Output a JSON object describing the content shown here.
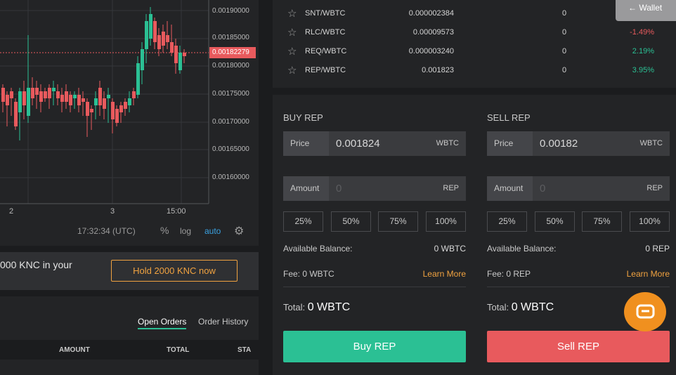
{
  "chart": {
    "price_ticks": [
      "0.00190000",
      "0.00185000",
      "0.00180000",
      "0.00175000",
      "0.00170000",
      "0.00165000",
      "0.00160000"
    ],
    "current_price": "0.00182279",
    "x_ticks": [
      "2",
      "3",
      "15:00"
    ],
    "time": "17:32:34 (UTC)",
    "pct": "%",
    "log": "log",
    "auto": "auto",
    "colors": {
      "up": "#2bc094",
      "down": "#e85a5d"
    }
  },
  "promo": {
    "text": "000 KNC in your",
    "button": "Hold 2000 KNC now"
  },
  "orders": {
    "tabs": [
      "Open Orders",
      "Order History"
    ],
    "columns": [
      "AMOUNT",
      "TOTAL",
      "STA"
    ]
  },
  "market": {
    "rows": [
      {
        "pair": "SNT/WBTC",
        "price": "0.000002384",
        "volume": "0",
        "change": "",
        "change_color": "#d4d4d4"
      },
      {
        "pair": "RLC/WBTC",
        "price": "0.00009573",
        "volume": "0",
        "change": "-1.49%",
        "change_color": "#e85a5d"
      },
      {
        "pair": "REQ/WBTC",
        "price": "0.000003240",
        "volume": "0",
        "change": "2.19%",
        "change_color": "#2bc094"
      },
      {
        "pair": "REP/WBTC",
        "price": "0.001823",
        "volume": "0",
        "change": "3.95%",
        "change_color": "#2bc094"
      }
    ],
    "wallet": "← Wallet"
  },
  "buy": {
    "title": "BUY REP",
    "price_label": "Price",
    "price_value": "0.001824",
    "price_unit": "WBTC",
    "amount_label": "Amount",
    "amount_placeholder": "0",
    "amount_unit": "REP",
    "pcts": [
      "25%",
      "50%",
      "75%",
      "100%"
    ],
    "available_label": "Available Balance:",
    "available_value": "0 WBTC",
    "fee": "Fee: 0 WBTC",
    "learn_more": "Learn More",
    "total_label": "Total:",
    "total_value": "0 WBTC",
    "action": "Buy REP"
  },
  "sell": {
    "title": "SELL REP",
    "price_label": "Price",
    "price_value": "0.00182",
    "price_unit": "WBTC",
    "amount_label": "Amount",
    "amount_placeholder": "0",
    "amount_unit": "REP",
    "pcts": [
      "25%",
      "50%",
      "75%",
      "100%"
    ],
    "available_label": "Available Balance:",
    "available_value": "0 REP",
    "fee": "Fee: 0 REP",
    "learn_more": "Learn More",
    "total_label": "Total:",
    "total_value": "0 WBTC",
    "action": "Sell REP"
  }
}
